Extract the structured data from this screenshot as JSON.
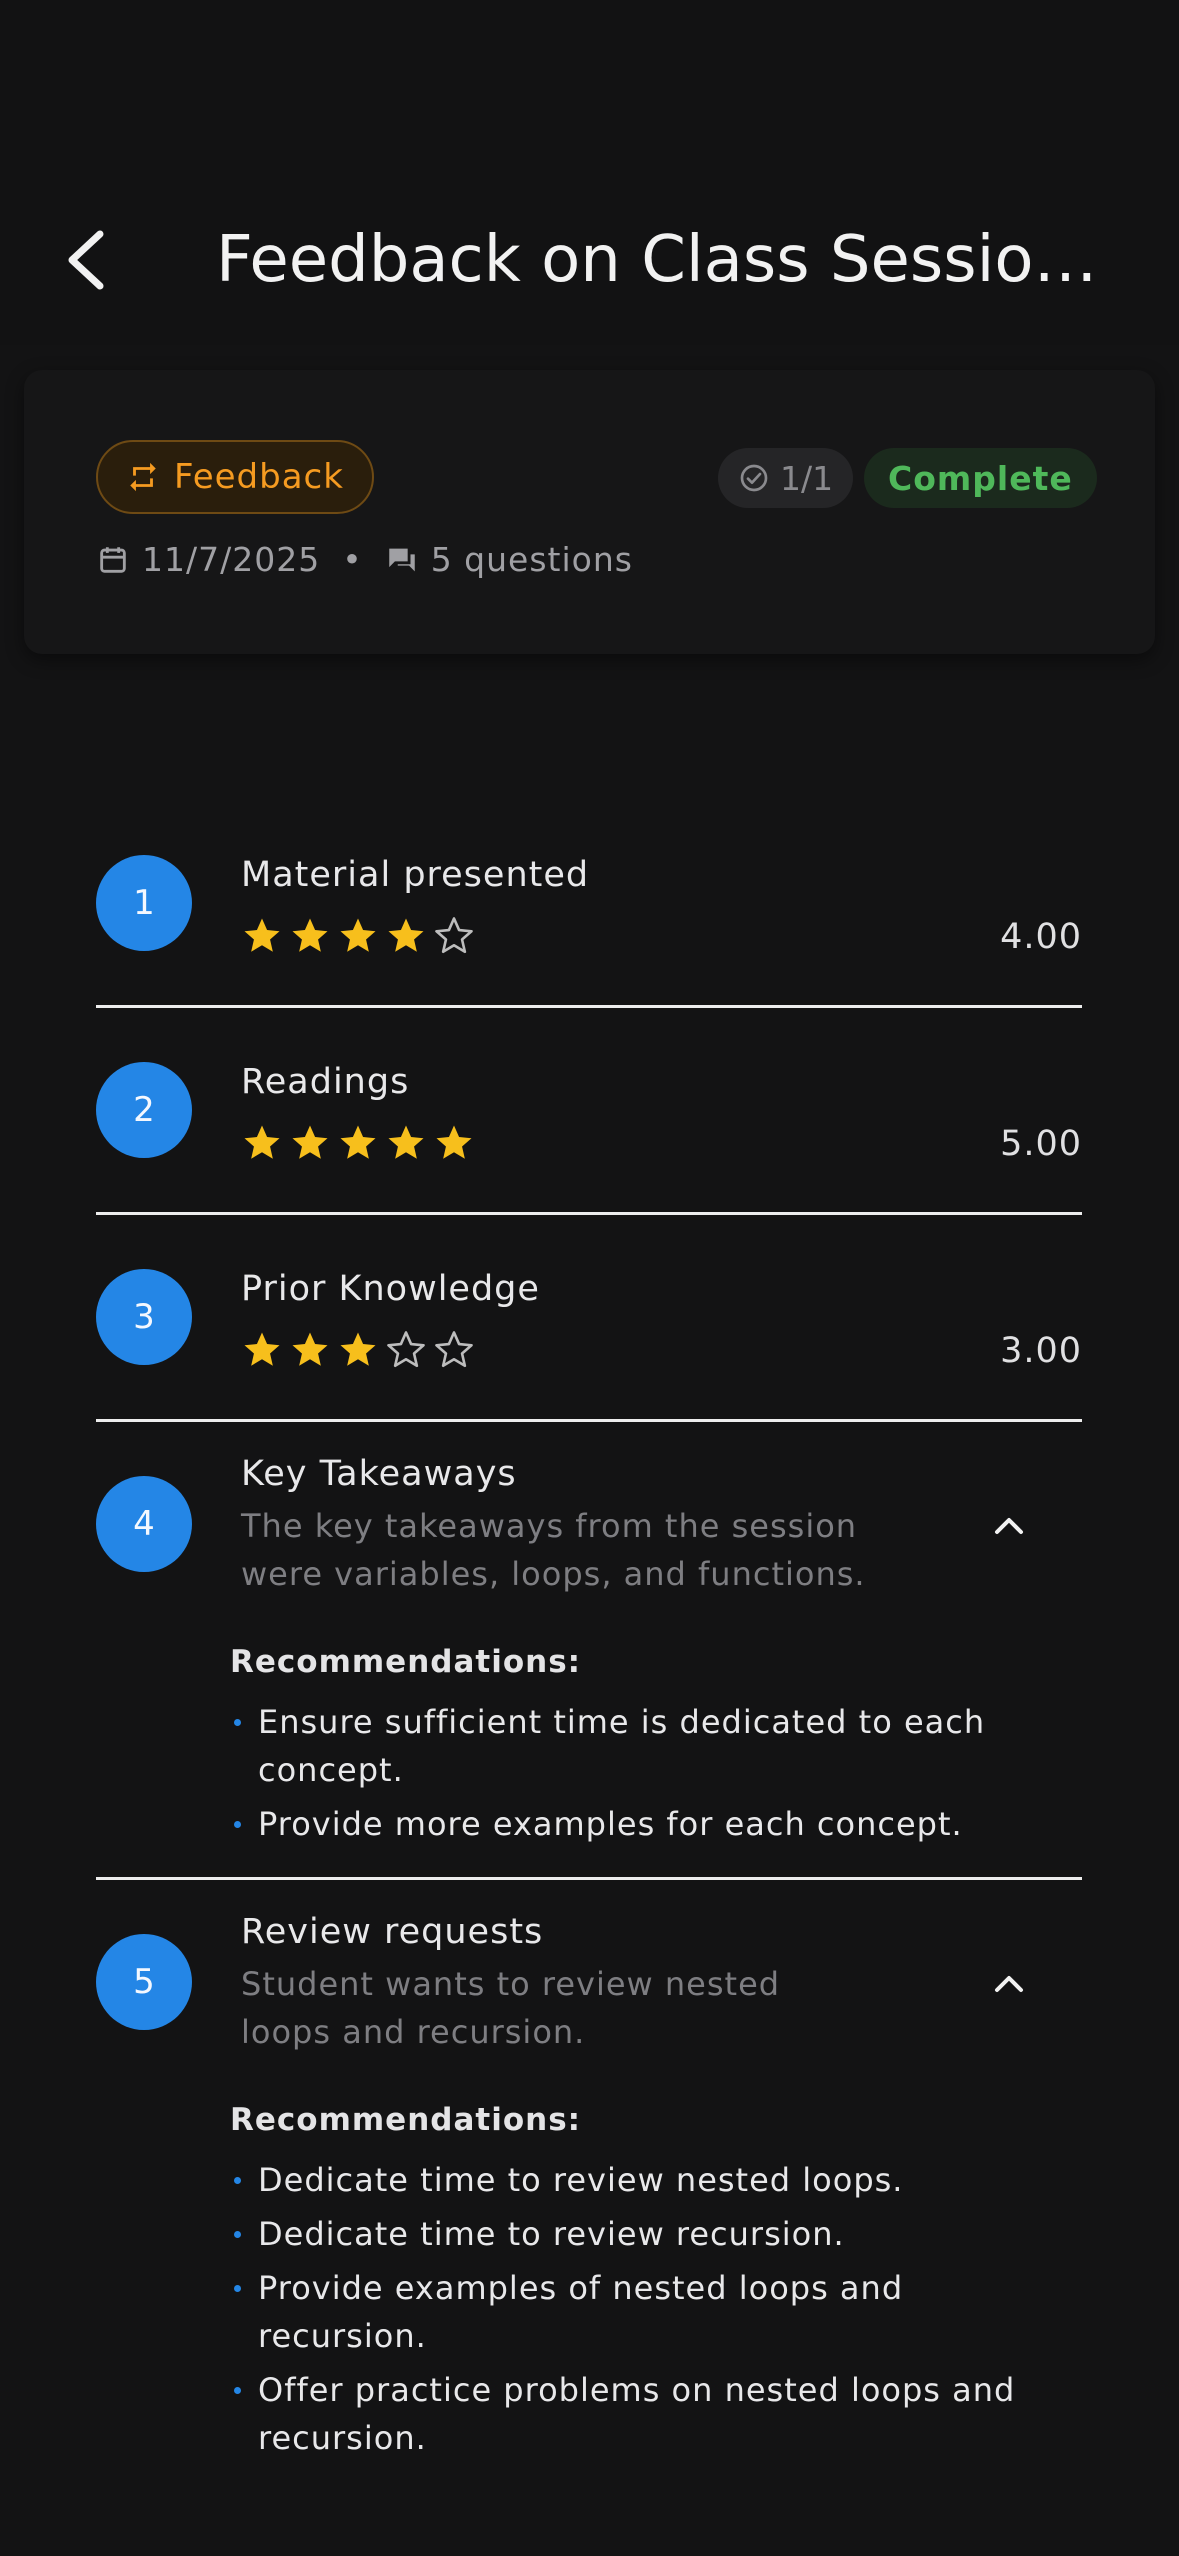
{
  "header": {
    "title": "Feedback on Class Session..."
  },
  "info": {
    "type_label": "Feedback",
    "count": "1/1",
    "status": "Complete",
    "date": "11/7/2025",
    "separator": "•",
    "questions": "5 questions"
  },
  "questions": [
    {
      "number": "1",
      "title": "Material presented",
      "rating": 4,
      "score": "4.00"
    },
    {
      "number": "2",
      "title": "Readings",
      "rating": 5,
      "score": "5.00"
    },
    {
      "number": "3",
      "title": "Prior Knowledge",
      "rating": 3,
      "score": "3.00"
    },
    {
      "number": "4",
      "title": "Key Takeaways",
      "answer": "The key takeaways from the session were variables, loops, and functions.",
      "rec_heading": "Recommendations:",
      "recommendations": [
        "Ensure sufficient time is dedicated to each concept.",
        "Provide more examples for each concept."
      ]
    },
    {
      "number": "5",
      "title": "Review requests",
      "answer": "Student wants to review nested loops and recursion.",
      "rec_heading": "Recommendations:",
      "recommendations": [
        "Dedicate time to review nested loops.",
        "Dedicate time to review recursion.",
        "Provide examples of nested loops and recursion.",
        "Offer practice problems on nested loops and recursion."
      ]
    }
  ],
  "colors": {
    "accent": "#2486e6",
    "star_filled": "#f7bf1c",
    "star_empty": "#bdbdbd",
    "feedback_chip": "#f59b21",
    "complete": "#4fb85a"
  }
}
